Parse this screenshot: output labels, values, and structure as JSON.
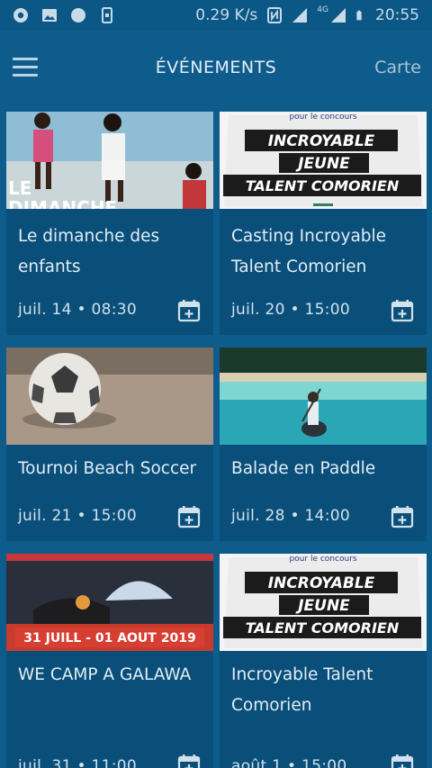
{
  "status_bar": {
    "network_speed": "0.29 K/s",
    "network_type": "4G",
    "time": "20:55",
    "icons": [
      "chrome-icon",
      "image-icon",
      "globe-icon",
      "phone-icon",
      "nfc-icon",
      "signal-icon",
      "battery-icon"
    ]
  },
  "appbar": {
    "title": "ÉVÉNEMENTS",
    "map_label": "Carte",
    "menu_icon": "hamburger-icon"
  },
  "events": [
    {
      "title": "Le dimanche des enfants",
      "date": "juil. 14 • 08:30",
      "thumb": "beach"
    },
    {
      "title": "Casting Incroyable Talent Comorien",
      "date": "juil. 20 • 15:00",
      "thumb": "poster"
    },
    {
      "title": "Tournoi Beach Soccer",
      "date": "juil. 21 • 15:00",
      "thumb": "sand"
    },
    {
      "title": "Balade en Paddle",
      "date": "juil. 28 • 14:00",
      "thumb": "sea"
    },
    {
      "title": "WE CAMP A GALAWA",
      "date": "juil. 31 • 11:00",
      "thumb": "camp"
    },
    {
      "title": "Incroyable Talent Comorien",
      "date": "août 1 • 15:00",
      "thumb": "poster"
    }
  ],
  "thumb_texts": {
    "beach_overlay_1": "LE",
    "beach_overlay_2": "DIMANCHE",
    "poster_top": "pour le concours",
    "poster_line1": "INCROYABLE",
    "poster_line2": "JEUNE",
    "poster_line3": "TALENT COMORIEN",
    "camp_banner": "31 JUILL - 01 AOUT 2019"
  },
  "colors": {
    "background": "#0e5c8c",
    "card": "#0a4f7a",
    "text": "#e2edf5"
  }
}
